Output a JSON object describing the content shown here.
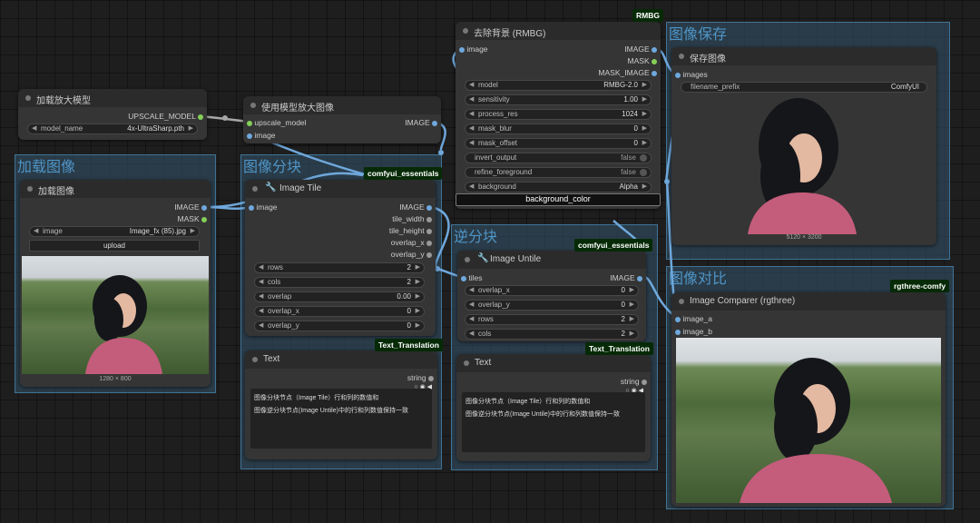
{
  "colors": {
    "link": "#6fa8dc",
    "group": "#34566e",
    "tag_bg": "#062a06"
  },
  "groups": {
    "load": {
      "title": "加载图像"
    },
    "tile": {
      "title": "图像分块"
    },
    "untile": {
      "title": "逆分块"
    },
    "save": {
      "title": "图像保存"
    },
    "compare": {
      "title": "图像对比"
    }
  },
  "tags": {
    "rmbg": "RMBG",
    "essentials1": "comfyui_essentials",
    "essentials2": "comfyui_essentials",
    "rgthree": "rgthree-comfy",
    "translation1": "Text_Translation",
    "translation2": "Text_Translation"
  },
  "upscale_loader": {
    "title": "加载放大模型",
    "output": "UPSCALE_MODEL",
    "model_name_label": "model_name",
    "model_name_value": "4x-UltraSharp.pth"
  },
  "upscale_image": {
    "title": "使用模型放大图像",
    "input1": "upscale_model",
    "input2": "image",
    "output": "IMAGE"
  },
  "load_image": {
    "title": "加载图像",
    "out1": "IMAGE",
    "out2": "MASK",
    "image_label": "image",
    "image_value": "Image_fx (85).jpg",
    "upload_label": "upload",
    "size": "1280 × 800",
    "preview_icon": "portrait-photo"
  },
  "image_tile": {
    "title": "Image Tile",
    "input": "image",
    "outputs": [
      "IMAGE",
      "tile_width",
      "tile_height",
      "overlap_x",
      "overlap_y"
    ],
    "widgets": [
      {
        "label": "rows",
        "value": "2"
      },
      {
        "label": "cols",
        "value": "2"
      },
      {
        "label": "overlap",
        "value": "0.00"
      },
      {
        "label": "overlap_x",
        "value": "0"
      },
      {
        "label": "overlap_y",
        "value": "0"
      }
    ]
  },
  "rmbg": {
    "title": "去除背景 (RMBG)",
    "input": "image",
    "outputs": [
      "IMAGE",
      "MASK",
      "MASK_IMAGE"
    ],
    "widgets": [
      {
        "label": "model",
        "value": "RMBG-2.0"
      },
      {
        "label": "sensitivity",
        "value": "1.00"
      },
      {
        "label": "process_res",
        "value": "1024"
      },
      {
        "label": "mask_blur",
        "value": "0"
      },
      {
        "label": "mask_offset",
        "value": "0"
      }
    ],
    "toggles": [
      {
        "label": "invert_output",
        "value": "false"
      },
      {
        "label": "refine_foreground",
        "value": "false"
      }
    ],
    "background_label": "background",
    "background_value": "Alpha",
    "bg_color_label": "background_color"
  },
  "image_untile": {
    "title": "Image Untile",
    "input": "tiles",
    "output": "IMAGE",
    "widgets": [
      {
        "label": "overlap_x",
        "value": "0"
      },
      {
        "label": "overlap_y",
        "value": "0"
      },
      {
        "label": "rows",
        "value": "2"
      },
      {
        "label": "cols",
        "value": "2"
      }
    ]
  },
  "text1": {
    "title": "Text",
    "output": "string",
    "lines": [
      "图像分块节点（Image Tile）行和列的数值和",
      "图像逆分块节点(Image Untile)中的行和列数值保持一致"
    ]
  },
  "text2": {
    "title": "Text",
    "output": "string",
    "lines": [
      "图像分块节点（Image Tile）行和列的数值和",
      "图像逆分块节点(Image Untile)中的行和列数值保持一致"
    ]
  },
  "save_image": {
    "title": "保存图像",
    "input": "images",
    "prefix_label": "filename_prefix",
    "prefix_value": "ComfyUI",
    "size": "5120 × 3200"
  },
  "comparer": {
    "title": "Image Comparer (rgthree)",
    "input1": "image_a",
    "input2": "image_b"
  }
}
